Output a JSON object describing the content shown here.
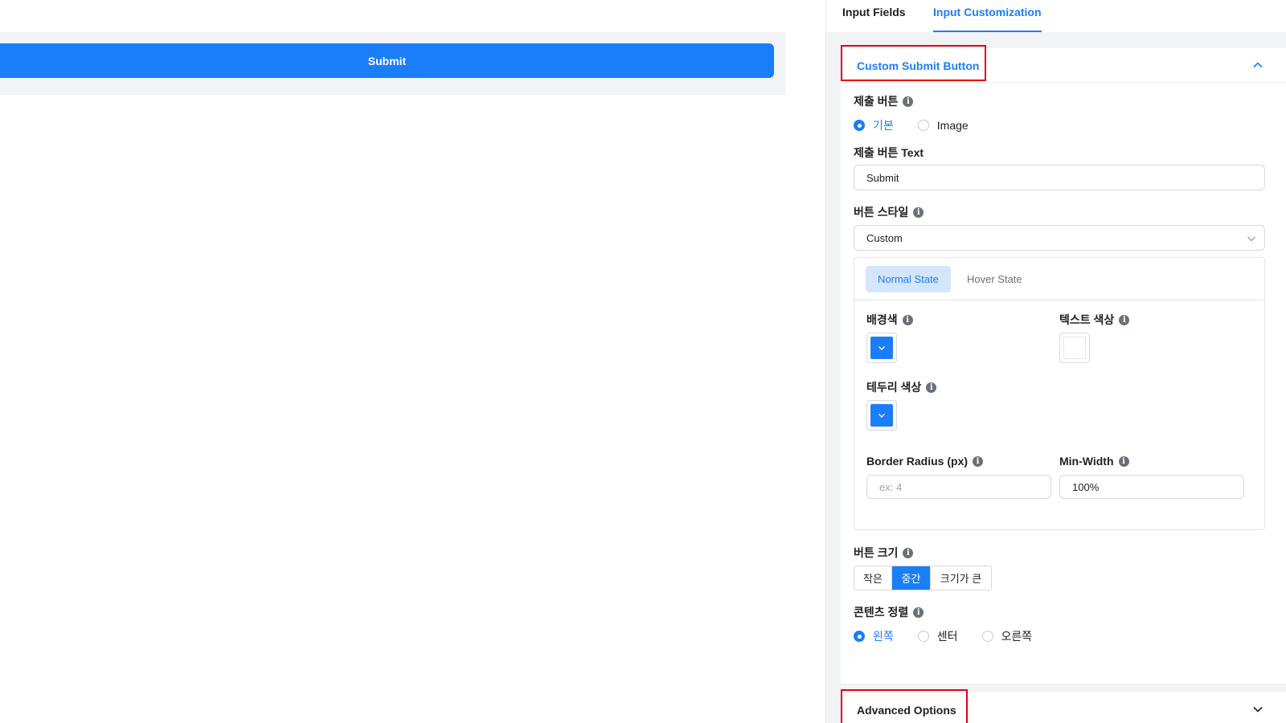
{
  "preview": {
    "submit_label": "Submit"
  },
  "tabs": [
    {
      "label": "Input Fields",
      "active": false
    },
    {
      "label": "Input Customization",
      "active": true
    }
  ],
  "custom_submit": {
    "title": "Custom Submit Button",
    "submit_type": {
      "label": "제출 버튼",
      "options": [
        {
          "label": "기본",
          "selected": true
        },
        {
          "label": "Image",
          "selected": false
        }
      ]
    },
    "text_label": "제출 버튼 Text",
    "text_value": "Submit",
    "style_label": "버튼 스타일",
    "style_value": "Custom",
    "states": [
      {
        "label": "Normal State",
        "active": true
      },
      {
        "label": "Hover State",
        "active": false
      }
    ],
    "bg_color_label": "배경색",
    "bg_color": "#1a7efb",
    "text_color_label": "텍스트 색상",
    "text_color": "#ffffff",
    "border_color_label": "테두리 색상",
    "border_color": "#1a7efb",
    "border_radius_label": "Border Radius (px)",
    "border_radius_placeholder": "ex: 4",
    "min_width_label": "Min-Width",
    "min_width_value": "100%",
    "size_label": "버튼 크기",
    "sizes": [
      {
        "label": "작은",
        "selected": false
      },
      {
        "label": "중간",
        "selected": true
      },
      {
        "label": "크기가 큰",
        "selected": false
      }
    ],
    "align_label": "콘텐츠 정렬",
    "align_options": [
      {
        "label": "왼쪽",
        "selected": true
      },
      {
        "label": "센터",
        "selected": false
      },
      {
        "label": "오른쪽",
        "selected": false
      }
    ]
  },
  "advanced": {
    "title": "Advanced Options"
  },
  "colors": {
    "accent": "#1a7efb",
    "highlight": "#e3000f",
    "panel_bg": "#f2f3f5"
  },
  "icons": {
    "info": "info-icon",
    "chevron_up": "chevron-up-icon",
    "chevron_down": "chevron-down-icon"
  }
}
